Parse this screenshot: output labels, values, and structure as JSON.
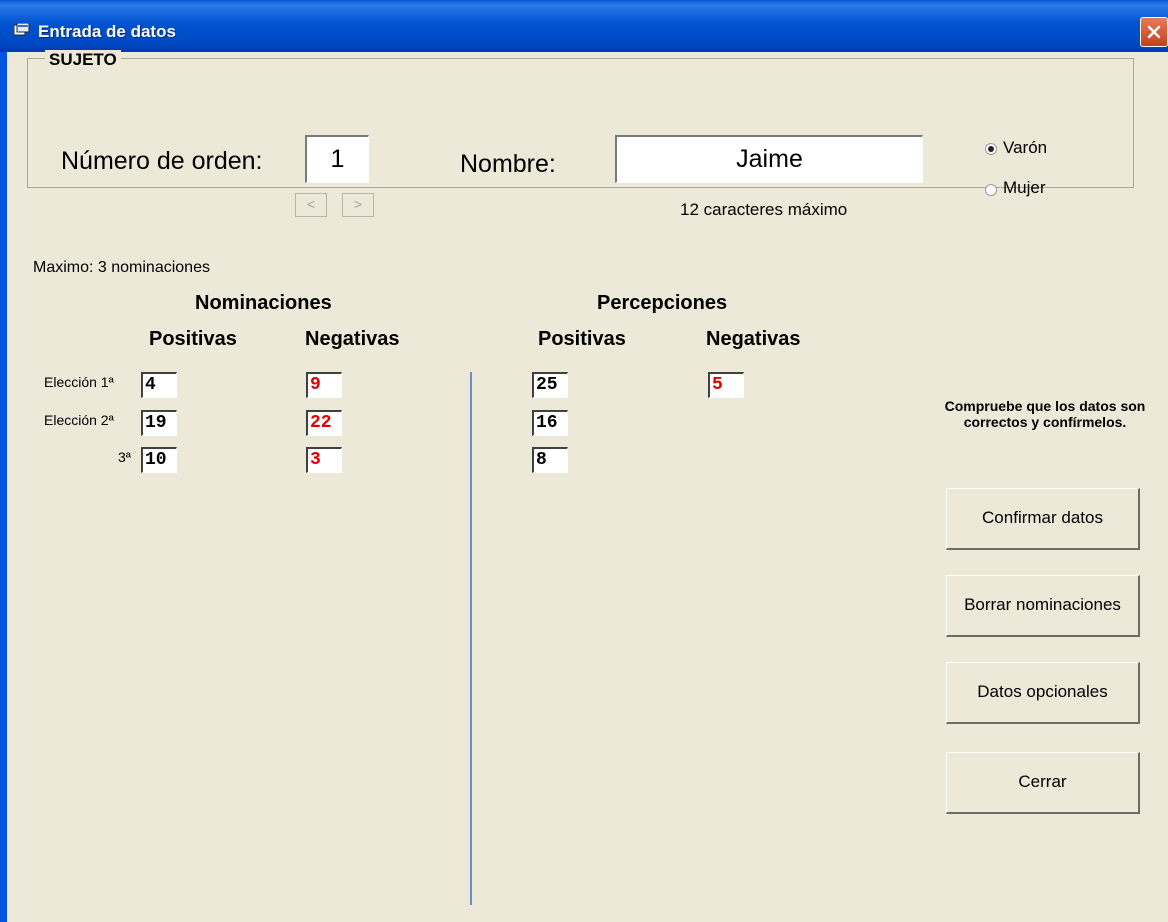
{
  "window": {
    "title": "Entrada de datos"
  },
  "subject": {
    "group_label": "SUJETO",
    "order_label": "Número de orden:",
    "order_value": "1",
    "prev_glyph": "<",
    "next_glyph": ">",
    "name_label": "Nombre:",
    "name_value": "Jaime",
    "name_hint": "12 caracteres máximo",
    "gender_options": [
      "Varón",
      "Mujer"
    ],
    "gender_selected": "Varón"
  },
  "max_note": "Maximo:  3 nominaciones",
  "nominations": {
    "title": "Nominaciones",
    "positive_label": "Positivas",
    "negative_label": "Negativas",
    "row_labels": [
      "Elección 1ª",
      "Elección 2ª",
      "3ª"
    ],
    "positive_values": [
      "4",
      "19",
      "10"
    ],
    "negative_values": [
      "9",
      "22",
      "3"
    ]
  },
  "perceptions": {
    "title": "Percepciones",
    "positive_label": "Positivas",
    "negative_label": "Negativas",
    "positive_values": [
      "25",
      "16",
      "8"
    ],
    "negative_values": [
      "5"
    ]
  },
  "confirm_note": "Compruebe que los datos son correctos y confírmelos.",
  "buttons": {
    "confirm": "Confirmar datos",
    "clear": "Borrar nominaciones",
    "optional": "Datos opcionales",
    "close": "Cerrar"
  },
  "colors": {
    "negative_value": "#e00000",
    "titlebar": "#0052d1"
  }
}
